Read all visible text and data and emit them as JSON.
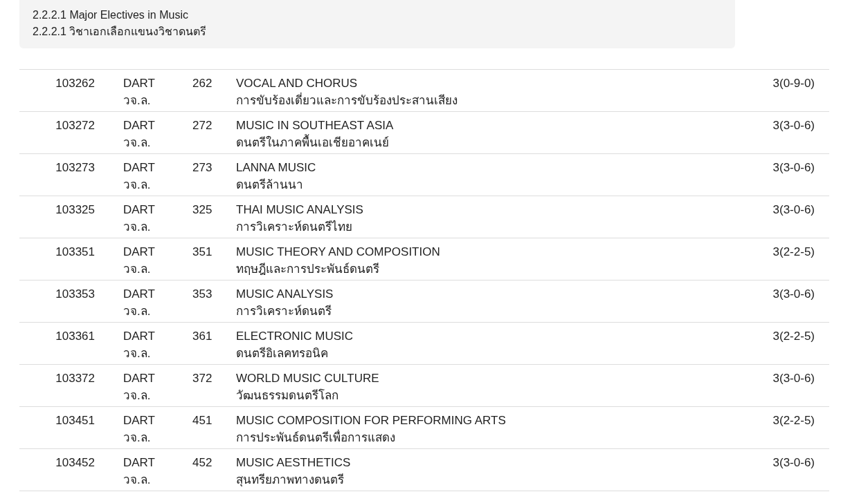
{
  "heading": {
    "lines": [
      "2.2.2.1 Major Electives in Music",
      "2.2.2.1 วิชาเอกเลือกแขนงวิชาดนตรี"
    ]
  },
  "courses": [
    {
      "code": "103262",
      "subject": "DART",
      "subject_th": "วจ.ล.",
      "number": "262",
      "title": "VOCAL AND CHORUS",
      "title_th": "การขับร้องเดี่ยวและการขับร้องประสานเสียง",
      "credits": "3(0-9-0)"
    },
    {
      "code": "103272",
      "subject": "DART",
      "subject_th": "วจ.ล.",
      "number": "272",
      "title": "MUSIC IN SOUTHEAST ASIA",
      "title_th": "ดนตรีในภาคพื้นเอเชียอาคเนย์",
      "credits": "3(3-0-6)"
    },
    {
      "code": "103273",
      "subject": "DART",
      "subject_th": "วจ.ล.",
      "number": "273",
      "title": "LANNA MUSIC",
      "title_th": "ดนตรีล้านนา",
      "credits": "3(3-0-6)"
    },
    {
      "code": "103325",
      "subject": "DART",
      "subject_th": "วจ.ล.",
      "number": "325",
      "title": "THAI MUSIC ANALYSIS",
      "title_th": "การวิเคราะห์ดนตรีไทย",
      "credits": "3(3-0-6)"
    },
    {
      "code": "103351",
      "subject": "DART",
      "subject_th": "วจ.ล.",
      "number": "351",
      "title": "MUSIC THEORY AND COMPOSITION",
      "title_th": "ทฤษฎีและการประพันธ์ดนตรี",
      "credits": "3(2-2-5)"
    },
    {
      "code": "103353",
      "subject": "DART",
      "subject_th": "วจ.ล.",
      "number": "353",
      "title": "MUSIC ANALYSIS",
      "title_th": "การวิเคราะห์ดนตรี",
      "credits": "3(3-0-6)"
    },
    {
      "code": "103361",
      "subject": "DART",
      "subject_th": "วจ.ล.",
      "number": "361",
      "title": "ELECTRONIC MUSIC",
      "title_th": "ดนตรีอิเลคทรอนิค",
      "credits": "3(2-2-5)"
    },
    {
      "code": "103372",
      "subject": "DART",
      "subject_th": "วจ.ล.",
      "number": "372",
      "title": "WORLD MUSIC CULTURE",
      "title_th": "วัฒนธรรมดนตรีโลก",
      "credits": "3(3-0-6)"
    },
    {
      "code": "103451",
      "subject": "DART",
      "subject_th": "วจ.ล.",
      "number": "451",
      "title": "MUSIC COMPOSITION FOR PERFORMING ARTS",
      "title_th": "การประพันธ์ดนตรีเพื่อการแสดง",
      "credits": "3(2-2-5)"
    },
    {
      "code": "103452",
      "subject": "DART",
      "subject_th": "วจ.ล.",
      "number": "452",
      "title": "MUSIC AESTHETICS",
      "title_th": "สุนทรียภาพทางดนตรี",
      "credits": "3(3-0-6)"
    }
  ]
}
